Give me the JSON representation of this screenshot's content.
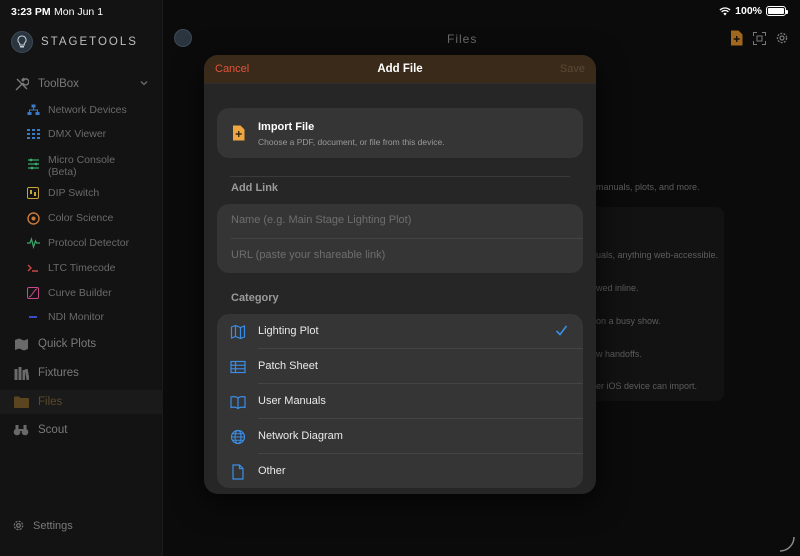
{
  "status": {
    "time": "3:23 PM",
    "date": "Mon Jun 1",
    "battery": "100%"
  },
  "brand": {
    "name": "STAGETOOLS"
  },
  "sidebar": {
    "toolbox_label": "ToolBox",
    "tools": [
      {
        "label": "Network Devices",
        "icon": "network-icon"
      },
      {
        "label": "DMX Viewer",
        "icon": "dmx-icon"
      },
      {
        "label": "Micro Console (Beta)",
        "icon": "sliders-icon"
      },
      {
        "label": "DIP Switch",
        "icon": "dip-switch-icon"
      },
      {
        "label": "Color Science",
        "icon": "color-icon"
      },
      {
        "label": "Protocol Detector",
        "icon": "waveform-icon"
      },
      {
        "label": "LTC Timecode",
        "icon": "timecode-icon"
      },
      {
        "label": "Curve Builder",
        "icon": "curve-icon"
      },
      {
        "label": "NDI Monitor",
        "icon": "ndi-icon"
      }
    ],
    "main": [
      {
        "label": "Quick Plots",
        "icon": "map-icon"
      },
      {
        "label": "Fixtures",
        "icon": "books-icon"
      },
      {
        "label": "Files",
        "icon": "folder-icon",
        "active": true
      },
      {
        "label": "Scout",
        "icon": "binoculars-icon"
      }
    ],
    "settings_label": "Settings"
  },
  "main": {
    "title": "Files",
    "bg_lines": [
      "manuals, plots, and more.",
      "uals, anything web-accessible.",
      "wed inline.",
      "on a busy show.",
      "w handoffs.",
      "er iOS device can import."
    ]
  },
  "modal": {
    "cancel_label": "Cancel",
    "title": "Add File",
    "save_label": "Save",
    "import_title": "Import File",
    "import_subtitle": "Choose a PDF, document, or file from this device.",
    "add_link_header": "Add Link",
    "name_placeholder": "Name  (e.g. Main Stage Lighting Plot)",
    "url_placeholder": "URL  (paste your shareable link)",
    "category_header": "Category",
    "categories": [
      {
        "label": "Lighting Plot",
        "icon": "map-icon",
        "selected": true
      },
      {
        "label": "Patch Sheet",
        "icon": "table-icon",
        "selected": false
      },
      {
        "label": "User Manuals",
        "icon": "book-icon",
        "selected": false
      },
      {
        "label": "Network Diagram",
        "icon": "globe-icon",
        "selected": false
      },
      {
        "label": "Other",
        "icon": "document-icon",
        "selected": false
      }
    ]
  },
  "colors": {
    "accent": "#f0a640",
    "cancel": "#e5523a",
    "check": "#3a8ee8",
    "modal_header": "#3a2a19"
  }
}
